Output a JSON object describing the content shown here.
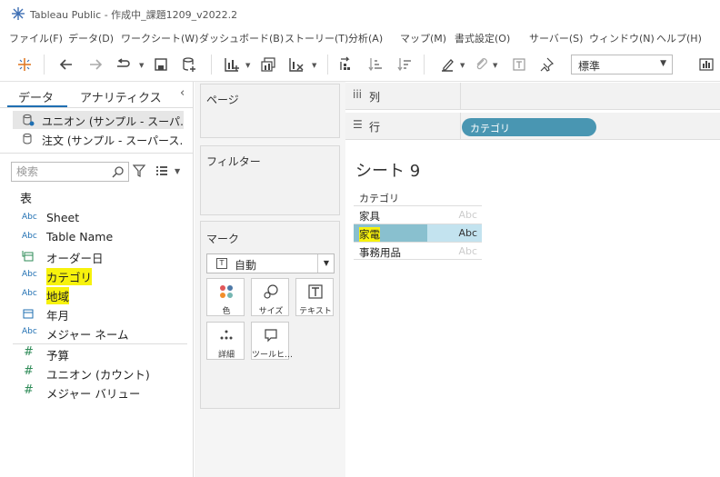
{
  "window": {
    "title": "Tableau Public - 作成中_課題1209_v2022.2"
  },
  "menu": [
    "ファイル(F)",
    "データ(D)",
    "ワークシート(W)",
    "ダッシュボード(B)",
    "ストーリー(T)",
    "分析(A)",
    "マップ(M)",
    "書式設定(O)",
    "サーバー(S)",
    "ウィンドウ(N)",
    "ヘルプ(H)"
  ],
  "toolbar": {
    "fit_value": "標準"
  },
  "datapane": {
    "tabs": [
      "データ",
      "アナリティクス"
    ],
    "datasources": [
      "ユニオン (サンプル - スーパ…",
      "注文 (サンプル - スーパース…"
    ],
    "search_placeholder": "検索",
    "table_header": "表",
    "dimensions": [
      {
        "type": "Abc",
        "name": "Sheet"
      },
      {
        "type": "Abc",
        "name": "Table Name"
      },
      {
        "type": "date",
        "name": "オーダー日"
      },
      {
        "type": "Abc",
        "name": "カテゴリ",
        "highlight": true
      },
      {
        "type": "Abc",
        "name": "地域",
        "highlight": true
      },
      {
        "type": "date",
        "name": "年月"
      },
      {
        "type": "Abc",
        "name": "メジャー ネーム"
      }
    ],
    "measures": [
      {
        "type": "#",
        "name": "予算"
      },
      {
        "type": "#",
        "name": "ユニオン (カウント)"
      },
      {
        "type": "#",
        "name": "メジャー バリュー"
      }
    ]
  },
  "cards": {
    "pages": "ページ",
    "filters": "フィルター",
    "marks": "マーク",
    "mark_type": "自動",
    "mark_buttons": [
      "色",
      "サイズ",
      "テキスト",
      "詳細",
      "ツールヒ…"
    ]
  },
  "shelves": {
    "columns_label": "列",
    "rows_label": "行",
    "rows_pill": "カテゴリ"
  },
  "viz": {
    "title": "シート 9",
    "header": "カテゴリ",
    "rows": [
      {
        "category": "家具",
        "value": "Abc",
        "selected": false
      },
      {
        "category": "家電",
        "value": "Abc",
        "selected": true
      },
      {
        "category": "事務用品",
        "value": "Abc",
        "selected": false
      }
    ]
  },
  "colors": {
    "pill": "#4996b2",
    "selection": "#c3e3ef",
    "highlight": "#f7f20c"
  }
}
